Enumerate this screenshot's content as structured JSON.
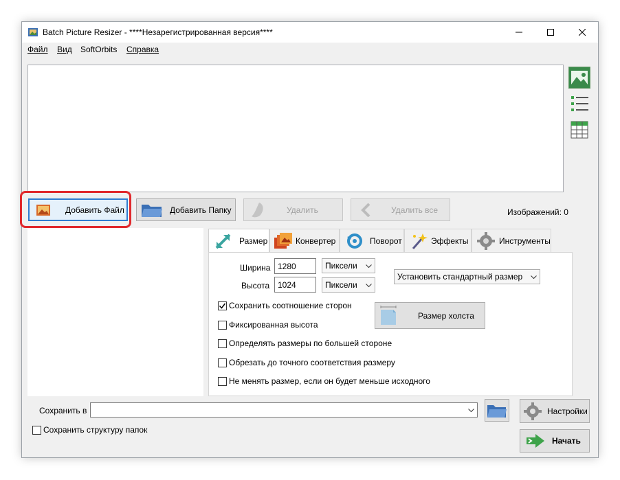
{
  "window": {
    "title": "Batch Picture Resizer - ****Незарегистрированная версия****"
  },
  "menu": {
    "items": [
      "Файл",
      "Вид",
      "SoftOrbits",
      "Справка"
    ]
  },
  "view_icons": [
    "image-view-icon",
    "list-view-icon",
    "grid-view-icon"
  ],
  "toolbar": {
    "add_file": "Добавить Файл",
    "add_folder": "Добавить Папку",
    "delete": "Удалить",
    "delete_all": "Удалить все",
    "images_count": "Изображений: 0"
  },
  "tabs": [
    {
      "label": "Размер",
      "icon": "resize-icon"
    },
    {
      "label": "Конвертер",
      "icon": "convert-icon"
    },
    {
      "label": "Поворот",
      "icon": "rotate-icon"
    },
    {
      "label": "Эффекты",
      "icon": "effects-icon"
    },
    {
      "label": "Инструменты",
      "icon": "tools-icon"
    }
  ],
  "size": {
    "width_label": "Ширина",
    "width_value": "1280",
    "width_unit": "Пиксели",
    "height_label": "Высота",
    "height_value": "1024",
    "height_unit": "Пиксели",
    "preset": "Установить стандартный размер",
    "canvas_button": "Размер холста",
    "options": [
      {
        "label": "Сохранить соотношение сторон",
        "checked": true
      },
      {
        "label": "Фиксированная высота",
        "checked": false
      },
      {
        "label": "Определять размеры по большей стороне",
        "checked": false
      },
      {
        "label": "Обрезать до точного соответствия размеру",
        "checked": false
      },
      {
        "label": "Не менять размер, если он будет меньше исходного",
        "checked": false
      }
    ]
  },
  "bottom": {
    "save_to_label": "Сохранить в",
    "save_to_value": "",
    "keep_structure": "Сохранить структуру папок",
    "settings": "Настройки",
    "start": "Начать"
  },
  "colors": {
    "highlight": "#e0282c",
    "accent_green": "#3ea34a"
  }
}
